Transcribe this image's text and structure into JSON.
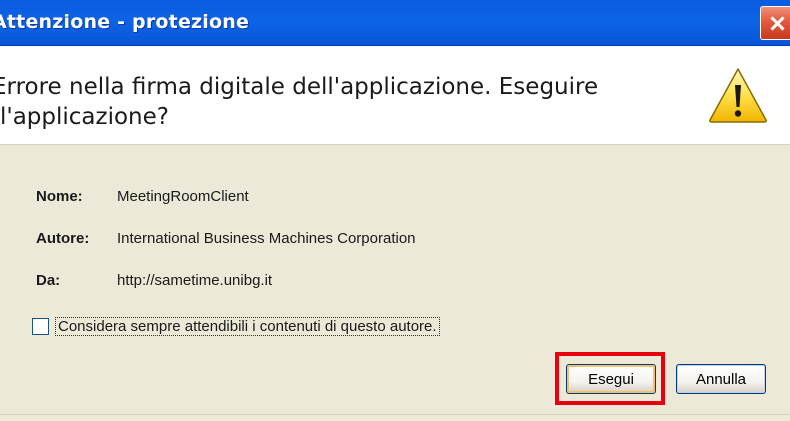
{
  "window": {
    "title": "Attenzione - protezione",
    "close_icon": "close-icon"
  },
  "header": {
    "message": "Errore nella firma digitale dell'applicazione. Eseguire l'applicazione?",
    "icon": "warning-icon"
  },
  "details": [
    {
      "label": "Nome:",
      "value": "MeetingRoomClient"
    },
    {
      "label": "Autore:",
      "value": "International Business Machines Corporation"
    },
    {
      "label": "Da:",
      "value": "http://sametime.unibg.it"
    }
  ],
  "trust_checkbox": {
    "label": "Considera sempre attendibili i contenuti di questo autore.",
    "checked": false
  },
  "buttons": {
    "run": "Esegui",
    "cancel": "Annulla"
  },
  "colors": {
    "titlebar": "#0a5be0",
    "close": "#e25a3c",
    "highlight": "#e8000c",
    "panel": "#ece9d8"
  }
}
